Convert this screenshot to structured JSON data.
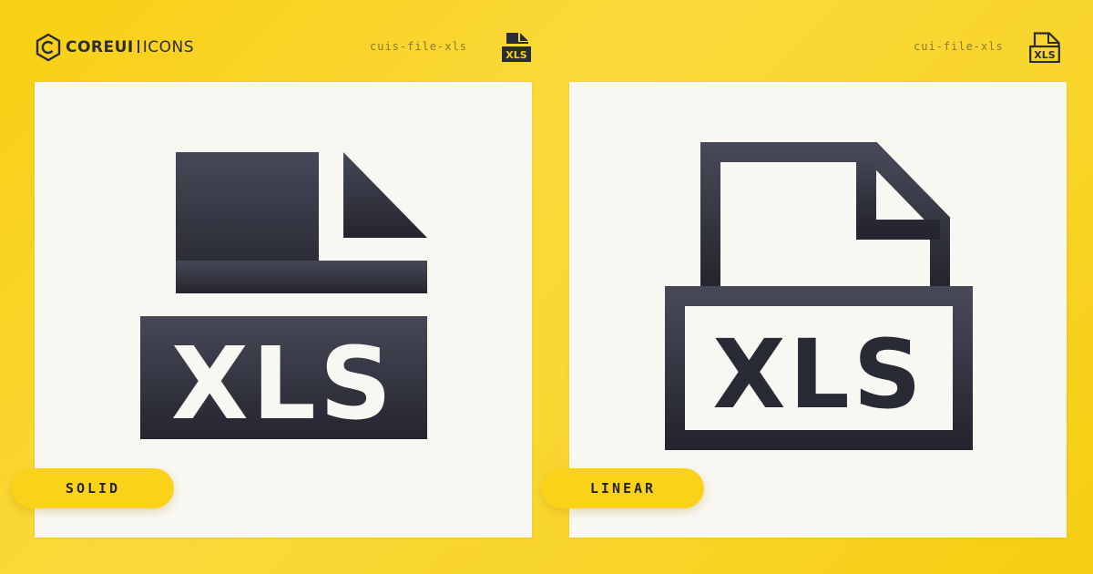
{
  "brand": {
    "name_bold": "COREUI",
    "name_light": "ICONS"
  },
  "variants": [
    {
      "icon_name": "cuis-file-xls",
      "badge": "SOLID",
      "glyph_text": "XLS"
    },
    {
      "icon_name": "cui-file-xls",
      "badge": "LINEAR",
      "glyph_text": "XLS"
    }
  ],
  "colors": {
    "background": "#f8cf12",
    "ink": "#2a2c37",
    "card": "#f8f7f2",
    "pill": "#fad21a"
  }
}
